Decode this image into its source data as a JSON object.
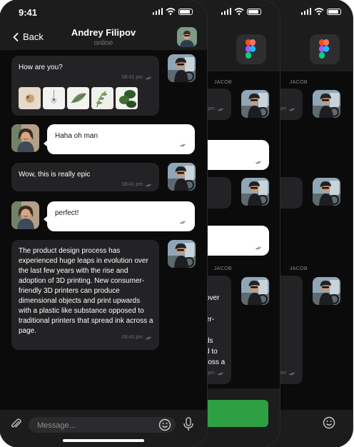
{
  "status_bar": {
    "time": "9:41"
  },
  "header": {
    "back_label": "Back",
    "contact_name": "Andrey Filipov",
    "contact_status": "online"
  },
  "messages": [
    {
      "text": "How are you?",
      "time": "06:41 pm"
    },
    {
      "text": "Haha oh man"
    },
    {
      "text": "Wow, this is really epic",
      "time": "06:41 pm"
    },
    {
      "text": "perfect!"
    },
    {
      "text": "The product design process has experienced huge leaps in evolution over the last few years with the rise and adoption of 3D printing. New consumer-friendly 3D printers can produce dimensional objects and print upwards with a plastic like substance opposed to traditional printers that spread ink across a page.",
      "time": "06:41 pm"
    }
  ],
  "input": {
    "placeholder": "Message..."
  },
  "background_screens": {
    "sender_labels": [
      "JACOB",
      "JACOB"
    ],
    "time_fragment": "pm",
    "fragment_lines": [
      "over",
      "er-",
      "ds",
      "d to",
      "ross a"
    ]
  },
  "colors": {
    "background": "#0b0b0b",
    "bar": "#1c1c1d",
    "incoming_bubble": "#232325",
    "outgoing_bubble": "#ffffff",
    "send_button": "#2ea043"
  }
}
